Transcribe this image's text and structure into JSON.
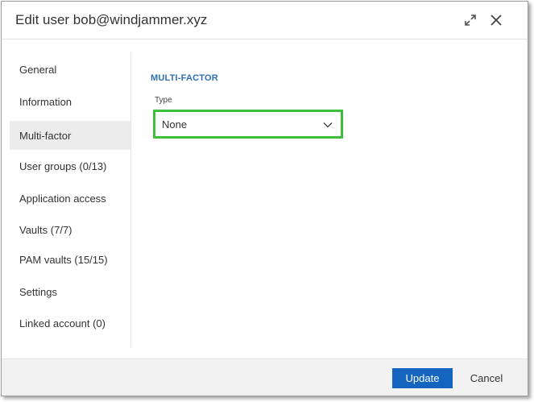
{
  "dialog": {
    "title": "Edit user bob@windjammer.xyz",
    "expand_icon": "expand-icon",
    "close_icon": "close-icon"
  },
  "sidebar": {
    "active_index": 2,
    "items": [
      {
        "label": "General"
      },
      {
        "label": "Information"
      },
      {
        "label": "Multi-factor"
      },
      {
        "label": "User groups (0/13)"
      },
      {
        "label": "Application access"
      },
      {
        "label": "Vaults (7/7)"
      },
      {
        "label": "PAM vaults (15/15)"
      },
      {
        "label": "Settings"
      },
      {
        "label": "Linked account (0)"
      }
    ]
  },
  "main": {
    "section_title": "MULTI-FACTOR",
    "type_field": {
      "label": "Type",
      "value": "None",
      "highlight_color": "#3cbf3c",
      "icon": "chevron-down-icon"
    }
  },
  "footer": {
    "update_label": "Update",
    "cancel_label": "Cancel",
    "primary_color": "#1565c0"
  }
}
